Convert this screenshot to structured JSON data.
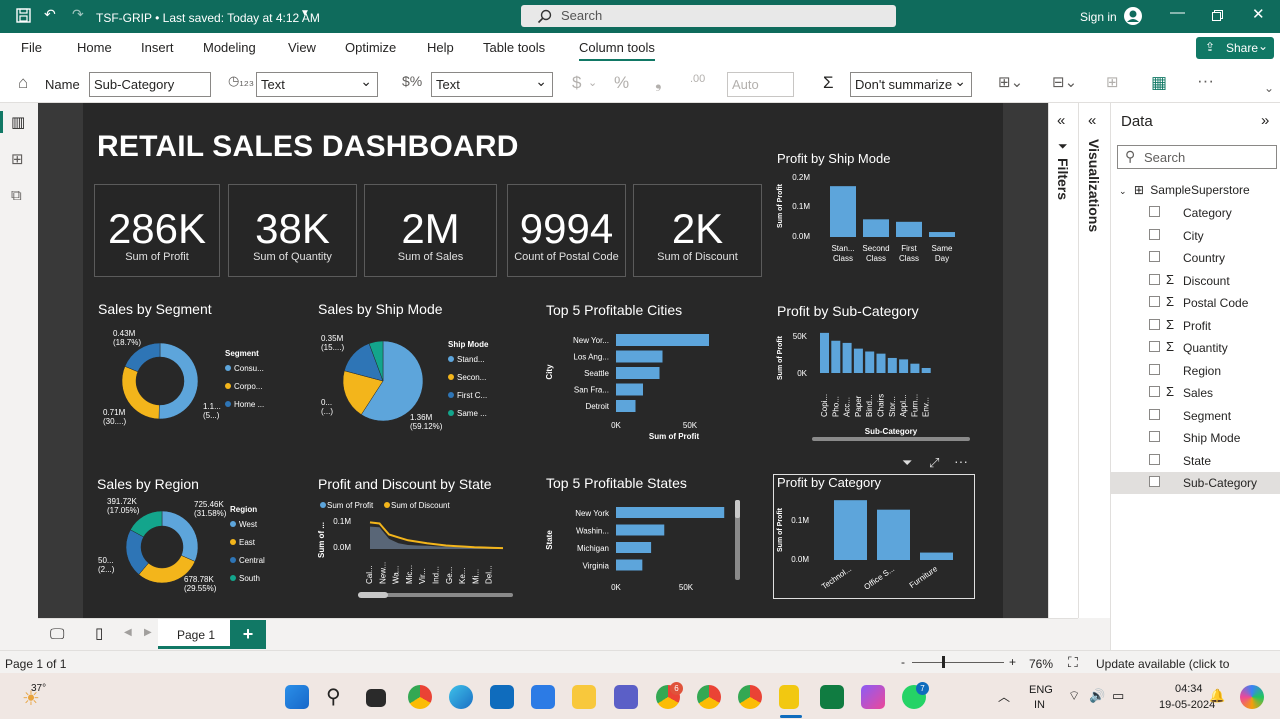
{
  "titlebar": {
    "doc_title": "TSF-GRIP • Last saved: Today at 4:12 AM",
    "search_placeholder": "Search",
    "sign_in": "Sign in"
  },
  "menu": {
    "file": "File",
    "home": "Home",
    "insert": "Insert",
    "modeling": "Modeling",
    "view": "View",
    "optimize": "Optimize",
    "help": "Help",
    "table_tools": "Table tools",
    "column_tools": "Column tools",
    "share": "Share"
  },
  "ribbon": {
    "name_label": "Name",
    "name_value": "Sub-Category",
    "data_type": "Text",
    "format": "Text",
    "decimal_auto": "Auto",
    "summarize": "Don't summarize",
    "currency_symbol": "$",
    "percent_symbol": "%",
    "comma_symbol": "❟",
    "decimal_symbol": ".00",
    "sigma_symbol": "Σ",
    "more_symbol": "···"
  },
  "report": {
    "title": "RETAIL SALES DASHBOARD",
    "kpis": [
      {
        "value": "286K",
        "label": "Sum of Profit"
      },
      {
        "value": "38K",
        "label": "Sum of Quantity"
      },
      {
        "value": "2M",
        "label": "Sum of Sales"
      },
      {
        "value": "9994",
        "label": "Count of Postal Code"
      },
      {
        "value": "2K",
        "label": "Sum of Discount"
      }
    ],
    "visual_titles": {
      "profit_ship_mode": "Profit by Ship Mode",
      "sales_segment": "Sales by Segment",
      "sales_ship_mode": "Sales by Ship Mode",
      "top_cities": "Top 5 Profitable Cities",
      "profit_subcat": "Profit by Sub-Category",
      "sales_region": "Sales by Region",
      "profit_discount_state": "Profit and Discount by State",
      "top_states": "Top 5 Profitable States",
      "profit_category": "Profit by Category"
    }
  },
  "chart_data": [
    {
      "type": "bar",
      "title": "Profit by Ship Mode",
      "ylabel": "Sum of Profit",
      "categories": [
        "Stan... Class",
        "Second Class",
        "First Class",
        "Same Day"
      ],
      "values": [
        164000,
        57000,
        49000,
        16000
      ],
      "ylim": [
        0,
        200000
      ],
      "ticks": [
        "0.2M",
        "0.1M",
        "0.0M"
      ]
    },
    {
      "type": "pie",
      "title": "Sales by Segment",
      "legend_title": "Segment",
      "categories": [
        "Consu...",
        "Corpo...",
        "Home ..."
      ],
      "values": [
        1.16,
        0.71,
        0.43
      ],
      "labels": [
        "1.1... (5...)",
        "0.71M (30....)",
        "0.43M (18.7%)"
      ]
    },
    {
      "type": "pie",
      "title": "Sales by Ship Mode",
      "legend_title": "Ship Mode",
      "categories": [
        "Stand...",
        "Secon...",
        "First C...",
        "Same ..."
      ],
      "values": [
        1.36,
        0.46,
        0.35,
        0.13
      ],
      "labels": [
        "1.36M (59.12%)",
        "0... (...)",
        "0.35M (15....)",
        ""
      ]
    },
    {
      "type": "bar",
      "title": "Top 5 Profitable Cities",
      "xlabel": "Sum of Profit",
      "ylabel": "City",
      "categories": [
        "New Yor...",
        "Los Ang...",
        "Seattle",
        "San Fra...",
        "Detroit"
      ],
      "values": [
        62000,
        31000,
        29000,
        18000,
        13000
      ],
      "xlim": [
        0,
        70000
      ],
      "ticks": [
        "0K",
        "50K"
      ]
    },
    {
      "type": "bar",
      "title": "Profit by Sub-Category",
      "xlabel": "Sub-Category",
      "ylabel": "Sum of Profit",
      "categories": [
        "Copi...",
        "Pho...",
        "Acc...",
        "Paper",
        "Bind...",
        "Chairs",
        "Stor...",
        "Appl...",
        "Furn...",
        "Env..."
      ],
      "values": [
        56000,
        45000,
        42000,
        34000,
        30000,
        27000,
        21000,
        19000,
        13000,
        7000
      ],
      "ticks": [
        "50K",
        "0K"
      ]
    },
    {
      "type": "pie",
      "title": "Sales by Region",
      "legend_title": "Region",
      "categories": [
        "West",
        "East",
        "Central",
        "South"
      ],
      "values": [
        725.46,
        678.78,
        501.24,
        391.72
      ],
      "labels": [
        "725.46K (31.58%)",
        "678.78K (29.55%)",
        "50... (2...)",
        "391.72K (17.05%)"
      ]
    },
    {
      "type": "area",
      "title": "Profit and Discount by State",
      "ylabel": "Sum of ...",
      "series": [
        {
          "name": "Sum of Profit",
          "values": [
            0.077,
            0.075,
            0.035,
            0.02,
            0.014,
            0.012,
            0.011,
            0.009,
            0.008,
            0.007,
            0.006,
            0.005,
            0.005,
            0.004,
            0.003
          ]
        },
        {
          "name": "Sum of Discount",
          "values": [
            0.092,
            0.088,
            0.05,
            0.04,
            0.03,
            0.025,
            0.02,
            0.016,
            0.012,
            0.01,
            0.008,
            0.006,
            0.005,
            0.004,
            0.003
          ]
        }
      ],
      "categories": [
        "Cal...",
        "New...",
        "Wa...",
        "Mic...",
        "Vir...",
        "Ind...",
        "Ge...",
        "Ke...",
        "Mi...",
        "Del..."
      ],
      "ticks": [
        "0.1M",
        "0.0M"
      ]
    },
    {
      "type": "bar",
      "title": "Top 5 Profitable States",
      "ylabel": "State",
      "categories": [
        "New York",
        "Washin...",
        "Michigan",
        "Virginia"
      ],
      "values": [
        74000,
        33000,
        24000,
        18000
      ],
      "xlim": [
        0,
        80000
      ],
      "ticks": [
        "0K",
        "50K"
      ]
    },
    {
      "type": "bar",
      "title": "Profit by Category",
      "ylabel": "Sum of Profit",
      "categories": [
        "Technol...",
        "Office S...",
        "Furniture"
      ],
      "values": [
        145000,
        122000,
        18000
      ],
      "ylim": [
        0,
        160000
      ],
      "ticks": [
        "0.1M",
        "0.0M"
      ]
    }
  ],
  "panes": {
    "filters": "Filters",
    "visualizations": "Visualizations",
    "data_title": "Data",
    "search_placeholder": "Search",
    "table_name": "SampleSuperstore",
    "fields": [
      {
        "name": "Category",
        "sigma": false
      },
      {
        "name": "City",
        "sigma": false
      },
      {
        "name": "Country",
        "sigma": false
      },
      {
        "name": "Discount",
        "sigma": true
      },
      {
        "name": "Postal Code",
        "sigma": true
      },
      {
        "name": "Profit",
        "sigma": true
      },
      {
        "name": "Quantity",
        "sigma": true
      },
      {
        "name": "Region",
        "sigma": false
      },
      {
        "name": "Sales",
        "sigma": true
      },
      {
        "name": "Segment",
        "sigma": false
      },
      {
        "name": "Ship Mode",
        "sigma": false
      },
      {
        "name": "State",
        "sigma": false
      },
      {
        "name": "Sub-Category",
        "sigma": false
      }
    ]
  },
  "pages": {
    "page_tab": "Page 1",
    "add": "+"
  },
  "status": {
    "page_info": "Page 1 of 1",
    "zoom": "76%",
    "update": "Update available (click to download)",
    "minus": "-",
    "plus": "+"
  },
  "taskbar": {
    "weather": "37°",
    "lang1": "ENG",
    "lang2": "IN",
    "time": "04:34",
    "date": "19-05-2024",
    "badge_teams": "6",
    "badge_whatsapp": "7"
  },
  "colors": {
    "accent": "#117865",
    "bar_blue": "#5da5db",
    "dark_blue": "#2e75b6",
    "orange": "#f3b51b",
    "teal": "#13a58c",
    "area_blue": "#5e6d7f"
  }
}
